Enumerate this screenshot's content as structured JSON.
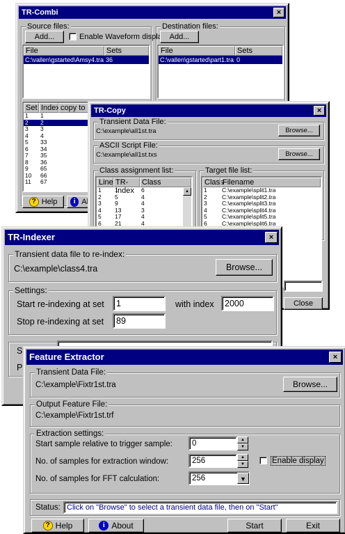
{
  "combi": {
    "title": "TR-Combi",
    "close": "×",
    "src_label": "Source files:",
    "dst_label": "Destination files:",
    "add": "Add...",
    "add2": "Add...",
    "wave_label": "Enable Waveform display",
    "col_file": "File",
    "col_sets": "Sets",
    "src_file": "C:\\vallen\\gstarted\\Amsy4.tra",
    "src_sets": "36",
    "dst_file": "C:\\vallen\\gstarted\\part1.tra",
    "dst_sets": "0",
    "col_set": "Set",
    "col_index": "Index",
    "col_copy": "copy to",
    "rows": [
      [
        "1",
        "1"
      ],
      [
        "2",
        "2"
      ],
      [
        "3",
        "3"
      ],
      [
        "4",
        "4"
      ],
      [
        "5",
        "33"
      ],
      [
        "6",
        "34"
      ],
      [
        "7",
        "35"
      ],
      [
        "8",
        "36"
      ],
      [
        "9",
        "65"
      ],
      [
        "10",
        "66"
      ],
      [
        "11",
        "67"
      ]
    ],
    "help": "Help",
    "about": "Abou"
  },
  "copy": {
    "title": "TR-Copy",
    "close": "×",
    "tdf_label": "Transient Data File:",
    "tdf_value": "C:\\example\\all1st.tra",
    "browse1": "Browse...",
    "asf_label": "ASCII Script File:",
    "asf_value": "C:\\example\\all1st.txs",
    "browse2": "Browse...",
    "cal_label": "Class assignment list:",
    "col_line": "Line",
    "col_tri": "TR-Index",
    "col_class": "Class",
    "cal_rows": [
      [
        "1",
        "1",
        "6"
      ],
      [
        "2",
        "5",
        "4"
      ],
      [
        "3",
        "9",
        "4"
      ],
      [
        "4",
        "13",
        "3"
      ],
      [
        "5",
        "17",
        "4"
      ],
      [
        "6",
        "21",
        "4"
      ]
    ],
    "tfl_label": "Target file list:",
    "col_class2": "Class",
    "col_fn": "Filename",
    "tfl_rows": [
      [
        "1",
        "C:\\example\\split1.tra"
      ],
      [
        "2",
        "C:\\example\\split2.tra"
      ],
      [
        "3",
        "C:\\example\\split3.tra"
      ],
      [
        "4",
        "C:\\example\\split4.tra"
      ],
      [
        "5",
        "C:\\example\\split5.tra"
      ],
      [
        "6",
        "C:\\example\\split6.tra"
      ]
    ],
    "close_btn": "Close"
  },
  "indexer": {
    "title": "TR-Indexer",
    "close": "×",
    "tdf_label": "Transient data file to re-index:",
    "tdf_value": "C:\\example\\class4.tra",
    "browse": "Browse...",
    "settings_label": "Settings:",
    "start_label": "Start re-indexing at set",
    "start_value": "1",
    "with_label": "with index",
    "with_value": "2000",
    "stop_label": "Stop re-indexing at set",
    "stop_value": "89",
    "st_partial": "St",
    "pr_partial": "Pr"
  },
  "fe": {
    "title": "Feature Extractor",
    "close": "×",
    "tdf_label": "Transient Data File:",
    "tdf_value": "C:\\example\\Fixtr1st.tra",
    "browse": "Browse...",
    "off_label": "Output Feature File:",
    "off_value": "C:\\example\\Fixtr1st.trf",
    "ext_label": "Extraction settings:",
    "start_label": "Start sample relative to trigger sample:",
    "start_value": "0",
    "nwin_label": "No. of samples for extraction window:",
    "nwin_value": "256",
    "enable_label": "Enable display",
    "fft_label": "No. of samples for FFT calculation:",
    "fft_value": "256",
    "status_label": "Status:",
    "status_text": "Click on \"Browse\" to select a transient data file, then on \"Start\"",
    "help": "Help",
    "about": "About",
    "start": "Start",
    "exit": "Exit"
  }
}
